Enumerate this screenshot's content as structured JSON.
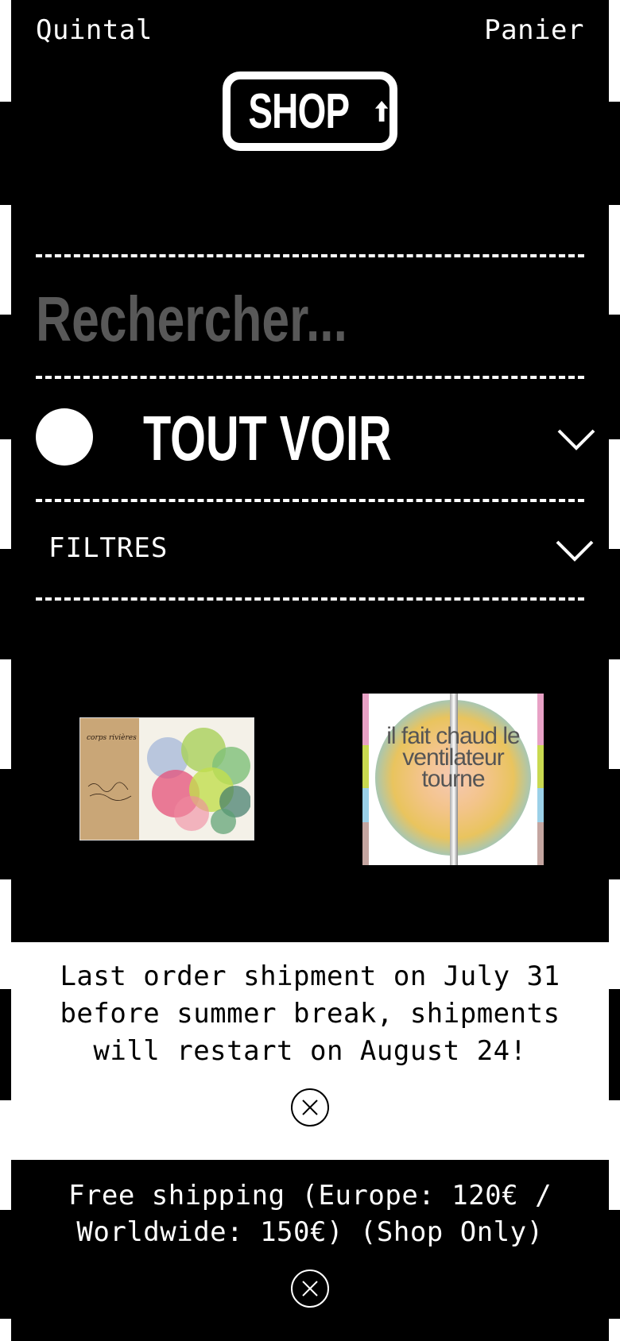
{
  "header": {
    "brand": "Quintal",
    "cart": "Panier",
    "logo_text": "SHOP"
  },
  "search": {
    "placeholder": "Rechercher..."
  },
  "category": {
    "label": "TOUT VOIR"
  },
  "filters": {
    "label": "FILTRES"
  },
  "products": [
    {
      "cover_small": "corps rivières"
    },
    {
      "cover_text": "il fait chaud le ventilateur tourne"
    }
  ],
  "notice": {
    "text": "Last order shipment on July 31\nbefore summer break, shipments\nwill restart on August 24!"
  },
  "footer": {
    "text": "Free shipping (Europe: 120€ /\nWorldwide: 150€) (Shop Only)"
  },
  "colors": {
    "background": "#000000",
    "foreground": "#ffffff",
    "placeholder": "#585858"
  }
}
